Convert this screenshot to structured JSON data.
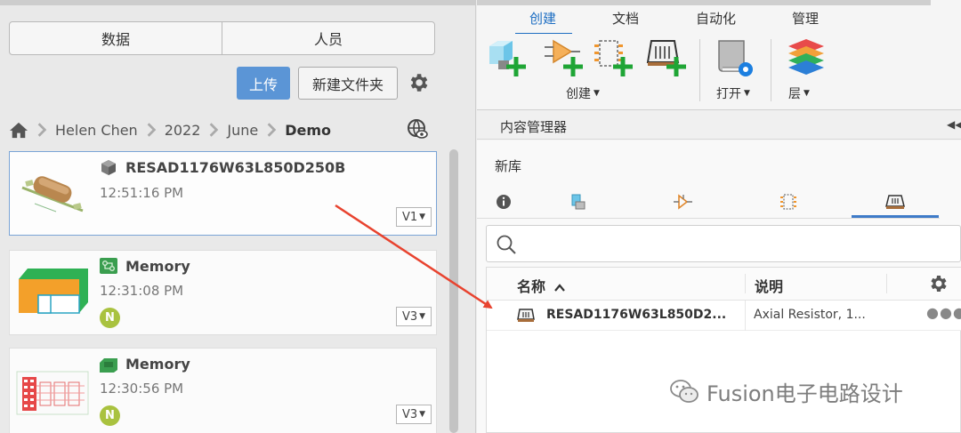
{
  "left": {
    "tabs": [
      "数据",
      "人员"
    ],
    "upload_label": "上传",
    "new_folder_label": "新建文件夹",
    "breadcrumb": [
      "Helen Chen",
      "2022",
      "June",
      "Demo"
    ],
    "items": [
      {
        "title": "RESAD1176W63L850D250B",
        "time": "12:51:16 PM",
        "version": "V1"
      },
      {
        "title": "Memory",
        "time": "12:31:08 PM",
        "version": "V3",
        "badge": "N"
      },
      {
        "title": "Memory",
        "time": "12:30:56 PM",
        "version": "V3",
        "badge": "N"
      }
    ]
  },
  "ribbon": {
    "tabs": [
      "创建",
      "文档",
      "自动化",
      "管理"
    ],
    "groups": [
      "创建",
      "打开",
      "层"
    ]
  },
  "content_manager": {
    "title": "内容管理器",
    "library": "新库",
    "search": {
      "value": "",
      "placeholder": ""
    },
    "columns": {
      "name": "名称",
      "description": "说明"
    },
    "rows": [
      {
        "name": "RESAD1176W63L850D2...",
        "description": "Axial Resistor, 1..."
      }
    ]
  },
  "watermark": "Fusion电子电路设计",
  "colors": {
    "accent": "#1c6dc2",
    "upload": "#5b95d6",
    "arrow": "#e8432f",
    "add": "#1fa535"
  },
  "icons": [
    "home-icon",
    "chevron-right-icon",
    "gear-icon",
    "globe-eye-icon",
    "search-icon",
    "info-icon",
    "package-icon",
    "sort-up-icon",
    "more-icon",
    "wechat-icon"
  ]
}
